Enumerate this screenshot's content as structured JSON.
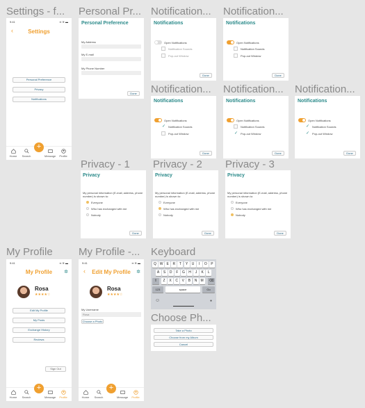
{
  "frames": {
    "settings": "Settings - f...",
    "personal": "Personal Pr...",
    "notif1": "Notification...",
    "notif2": "Notification...",
    "notif3": "Notification...",
    "notif4": "Notification...",
    "notif5": "Notification...",
    "privacy1": "Privacy - 1",
    "privacy2": "Privacy - 2",
    "privacy3": "Privacy - 3",
    "myprofile": "My Profile",
    "myprofile2": "My Profile -...",
    "keyboard": "Keyboard",
    "choose": "Choose Ph..."
  },
  "status": {
    "time": "9:41",
    "icons": "▪▪ ≋ ▬"
  },
  "settings": {
    "title": "Settings",
    "items": [
      "Personal Preference",
      "Privacy",
      "Notifications"
    ]
  },
  "tabs": {
    "home": "Home",
    "search": "Search",
    "message": "Message",
    "profile": "Profile"
  },
  "personal": {
    "title": "Personal Preference",
    "address": "My Address",
    "email": "My E-mail",
    "phone": "My Phone Number",
    "done": "Done"
  },
  "notifications": {
    "title": "Notifications",
    "open": "Open Notifications",
    "sounds": "Notification Sounds",
    "popout": "Pop-out Window",
    "done": "Done"
  },
  "privacy": {
    "title": "Privacy",
    "question": "My personal information (E-mail, address, phone number) is shown to:",
    "options": [
      "Everyone",
      "Who has exchanged with me",
      "Nobody"
    ],
    "done": "Done"
  },
  "profile": {
    "title": "My Profile",
    "edit_title": "Edit My Profile",
    "name": "Rosa",
    "stars": "★★★★☆",
    "buttons": [
      "Edit My Profile",
      "My Posts",
      "Exchange History",
      "Reviews"
    ],
    "signout": "Sign Out",
    "username_label": "My Username",
    "username_value": "Rosa",
    "choose_photo": "Choose a Photo"
  },
  "keyboard": {
    "row1": [
      "Q",
      "W",
      "E",
      "R",
      "T",
      "Y",
      "U",
      "I",
      "O",
      "P"
    ],
    "row2": [
      "A",
      "S",
      "D",
      "F",
      "G",
      "H",
      "J",
      "K",
      "L"
    ],
    "row3": [
      "Z",
      "X",
      "C",
      "V",
      "B",
      "N",
      "M"
    ],
    "shift": "⇧",
    "back": "⌫",
    "num": "123",
    "space": "space",
    "go": "Go",
    "emoji": "☺",
    "mic": "🎙"
  },
  "choose_photo": {
    "options": [
      "Take a Photo",
      "Choose from my Album",
      "Cancel"
    ]
  },
  "colors": {
    "teal": "#2b8a8a",
    "orange": "#f0a030",
    "bg": "#e6e6e6"
  }
}
